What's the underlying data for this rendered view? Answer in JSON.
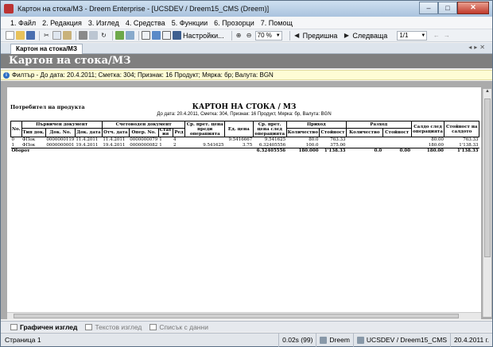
{
  "window": {
    "title": "Картон на стока/МЗ - Dreem Enterprise - [UCSDEV / Dreem15_CMS (Dreem)]",
    "minimize": "–",
    "maximize": "□",
    "close": "✕"
  },
  "menu": [
    "1. Файл",
    "2. Редакция",
    "3. Изглед",
    "4. Средства",
    "5. Функции",
    "6. Прозорци",
    "7. Помощ"
  ],
  "toolbar": {
    "settings_label": "Настройки...",
    "zoom_value": "70 %",
    "prev_label": "Предишна",
    "next_label": "Следваща",
    "page_value": "1/1"
  },
  "doc_tab": {
    "label": "Картон на стока/МЗ"
  },
  "banner": {
    "title": "Картон на стока/МЗ"
  },
  "filter": {
    "text": "Филтър - До дата: 20.4.2011; Сметка: 304; Признак: 16 Продукт; Мярка: бр; Валута: BGN"
  },
  "report": {
    "title": "КАРТОН НА СТОКА / МЗ",
    "subtitle": "До дата: 20.4.2011, Сметка: 304, Признак: 16 Продукт, Мярка: бр, Валута: BGN",
    "consumer_label": "Потребител на продукта",
    "group_headers": {
      "no": "No.",
      "primary_doc": "Първичен документ",
      "accounting_doc": "Счетоводен документ",
      "avg_price_before": "Ср. прет. цена преди операцията",
      "unit_price": "Ед. цена",
      "avg_price_after": "Ср. прет. цена след операцията",
      "income": "Приход",
      "expense": "Разход",
      "balance_after": "Салдо след операцията",
      "value_balance": "Стойност на салдото"
    },
    "sub_headers": {
      "doc_type": "Тип док.",
      "doc_no": "Док. No.",
      "doc_date": "Док. дата",
      "acc_date": "Отч. дата",
      "oper_no": "Опер. No.",
      "status": "Стат ия",
      "row": "Ред",
      "qty_in": "Количество",
      "value_in": "Стойност",
      "qty_out": "Количество",
      "value_out": "Стойност"
    },
    "rows": [
      {
        "no": "0",
        "type": "ФПок",
        "doc_no": "0000000119",
        "doc_date": "11.4.2011",
        "acc_date": "11.4.2011",
        "oper_no": "0000000079",
        "status": "1",
        "row": "4",
        "avg_before": "",
        "unit_price": "9.5416667",
        "avg_after": "9.541625",
        "qty_in": "80.0",
        "val_in": "763.33",
        "qty_out": "",
        "val_out": "",
        "balance": "80.00",
        "val_balance": "763.33"
      },
      {
        "no": "1",
        "type": "ФПок",
        "doc_no": "0000000001",
        "doc_date": "19.4.2011",
        "acc_date": "19.4.2011",
        "oper_no": "0000000082",
        "status": "1",
        "row": "2",
        "avg_before": "9.541625",
        "unit_price": "3.75",
        "avg_after": "6.32405556",
        "qty_in": "100.0",
        "val_in": "375.00",
        "qty_out": "",
        "val_out": "",
        "balance": "180.00",
        "val_balance": "1'138.33"
      }
    ],
    "total": {
      "label": "Оборот",
      "avg_after": "6.32405556",
      "qty_in": "180.000",
      "val_in": "1'138.33",
      "qty_out": "0.0",
      "val_out": "0.00",
      "balance": "180.00",
      "val_balance": "1'138.33"
    }
  },
  "view_tabs": [
    "Графичен изглед",
    "Текстов изглед",
    "Списък с данни"
  ],
  "status": {
    "page": "Страница 1",
    "time": "0.02s (99)",
    "app": "Dreem",
    "db": "UCSDEV / Dreem15_CMS",
    "date": "20.4.2011 г."
  }
}
